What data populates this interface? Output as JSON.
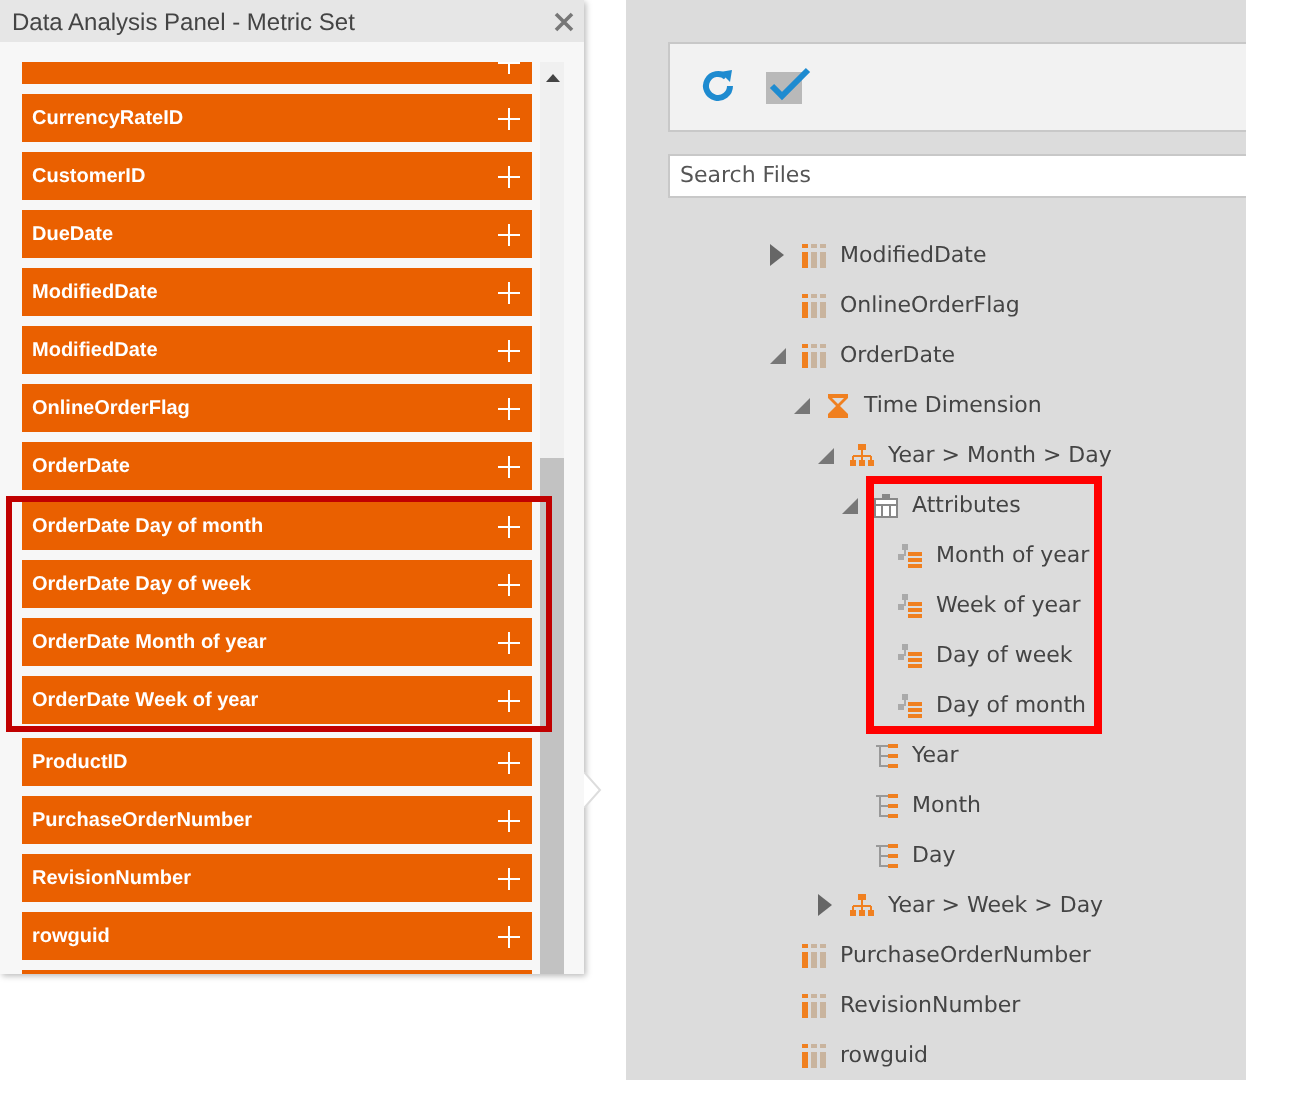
{
  "panel": {
    "title": "Data Analysis Panel - Metric Set",
    "items": [
      {
        "label": "CurrencyRateID",
        "highlighted": false
      },
      {
        "label": "CustomerID",
        "highlighted": false
      },
      {
        "label": "DueDate",
        "highlighted": false
      },
      {
        "label": "ModifiedDate",
        "highlighted": false
      },
      {
        "label": "ModifiedDate",
        "highlighted": false
      },
      {
        "label": "OnlineOrderFlag",
        "highlighted": false
      },
      {
        "label": "OrderDate",
        "highlighted": false
      },
      {
        "label": "OrderDate Day of month",
        "highlighted": true
      },
      {
        "label": "OrderDate Day of week",
        "highlighted": true
      },
      {
        "label": "OrderDate Month of year",
        "highlighted": true
      },
      {
        "label": "OrderDate Week of year",
        "highlighted": true
      },
      {
        "label": "ProductID",
        "highlighted": false
      },
      {
        "label": "PurchaseOrderNumber",
        "highlighted": false
      },
      {
        "label": "RevisionNumber",
        "highlighted": false
      },
      {
        "label": "rowguid",
        "highlighted": false
      }
    ]
  },
  "explorer": {
    "search": {
      "placeholder": "Search Files"
    },
    "tree": [
      {
        "label": "ModifiedDate",
        "kind": "column",
        "expanded": false
      },
      {
        "label": "OnlineOrderFlag",
        "kind": "column"
      },
      {
        "label": "OrderDate",
        "kind": "column",
        "expanded": true,
        "children": [
          {
            "label": "Time Dimension",
            "kind": "time",
            "expanded": true,
            "children": [
              {
                "label": "Year > Month > Day",
                "kind": "hierarchy",
                "expanded": true,
                "children": [
                  {
                    "label": "Attributes",
                    "kind": "attributes",
                    "expanded": true,
                    "highlighted": true,
                    "children": [
                      {
                        "label": "Month of year",
                        "kind": "attribute"
                      },
                      {
                        "label": "Week of year",
                        "kind": "attribute"
                      },
                      {
                        "label": "Day of week",
                        "kind": "attribute"
                      },
                      {
                        "label": "Day of month",
                        "kind": "attribute"
                      }
                    ]
                  },
                  {
                    "label": "Year",
                    "kind": "level"
                  },
                  {
                    "label": "Month",
                    "kind": "level"
                  },
                  {
                    "label": "Day",
                    "kind": "level"
                  }
                ]
              },
              {
                "label": "Year > Week > Day",
                "kind": "hierarchy",
                "expanded": false
              }
            ]
          }
        ]
      },
      {
        "label": "PurchaseOrderNumber",
        "kind": "column"
      },
      {
        "label": "RevisionNumber",
        "kind": "column"
      },
      {
        "label": "rowguid",
        "kind": "column"
      }
    ]
  }
}
